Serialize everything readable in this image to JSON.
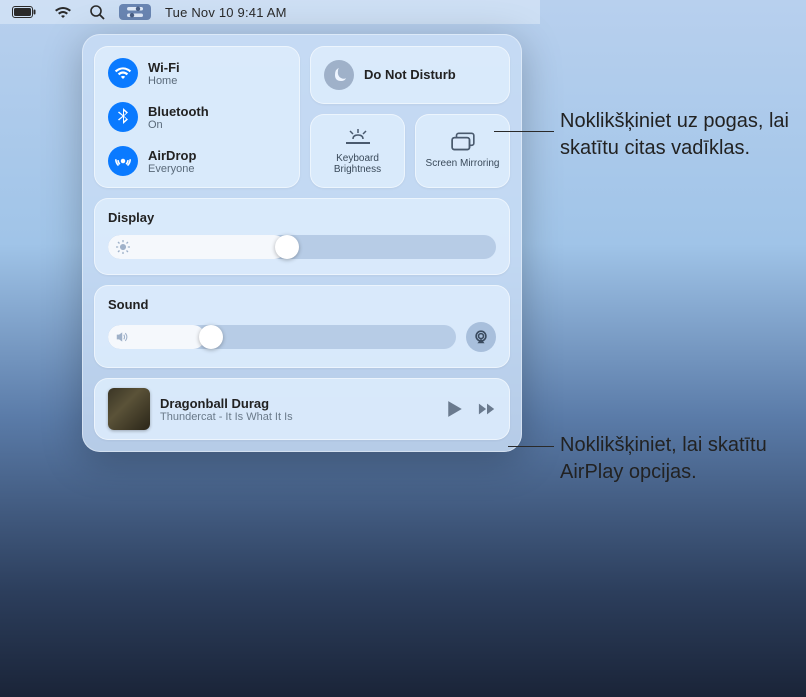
{
  "menubar": {
    "datetime": "Tue Nov 10  9:41 AM"
  },
  "connectivity": {
    "wifi": {
      "title": "Wi-Fi",
      "sub": "Home"
    },
    "bluetooth": {
      "title": "Bluetooth",
      "sub": "On"
    },
    "airdrop": {
      "title": "AirDrop",
      "sub": "Everyone"
    }
  },
  "dnd": {
    "title": "Do Not Disturb"
  },
  "keyboard_brightness": {
    "label": "Keyboard Brightness"
  },
  "screen_mirroring": {
    "label": "Screen Mirroring"
  },
  "display": {
    "title": "Display",
    "value": 46
  },
  "sound": {
    "title": "Sound",
    "value": 28
  },
  "nowplaying": {
    "title": "Dragonball Durag",
    "subtitle": "Thundercat - It Is What It Is"
  },
  "annotations": {
    "dnd": "Noklikšķiniet uz pogas, lai skatītu citas vadīklas.",
    "airplay": "Noklikšķiniet, lai skatītu AirPlay opcijas."
  }
}
